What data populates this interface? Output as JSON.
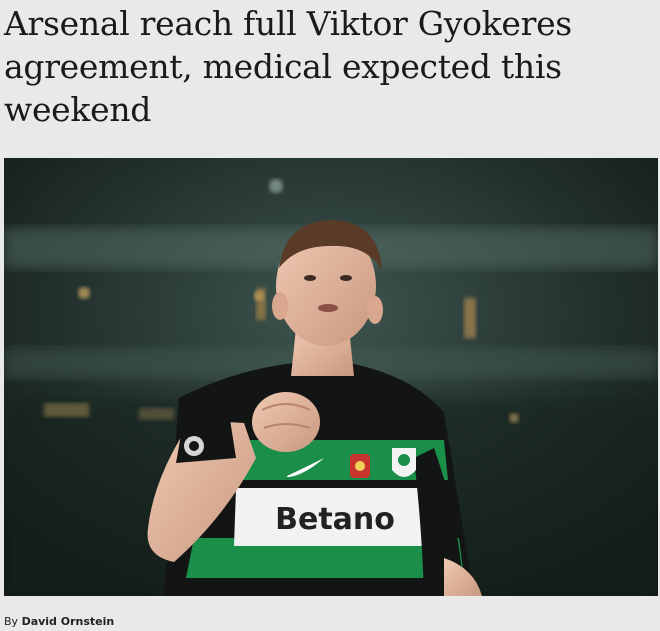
{
  "article": {
    "headline": "Arsenal reach full Viktor Gyokeres agreement, medical expected this weekend",
    "byline_prefix": "By ",
    "byline_author": "David Ornstein"
  },
  "photo": {
    "sponsor_text": "Betano",
    "icons": [
      "stadium-background",
      "player-figure",
      "nike-swoosh-icon",
      "portugal-crest-icon",
      "sporting-crest-icon",
      "champions-league-badge-icon"
    ]
  },
  "colors": {
    "background": "#e9e9e9",
    "headline": "#1a1a1a",
    "kit_green": "#1b8f4a",
    "kit_black": "#121513",
    "stadium": "#1f2f2b"
  }
}
